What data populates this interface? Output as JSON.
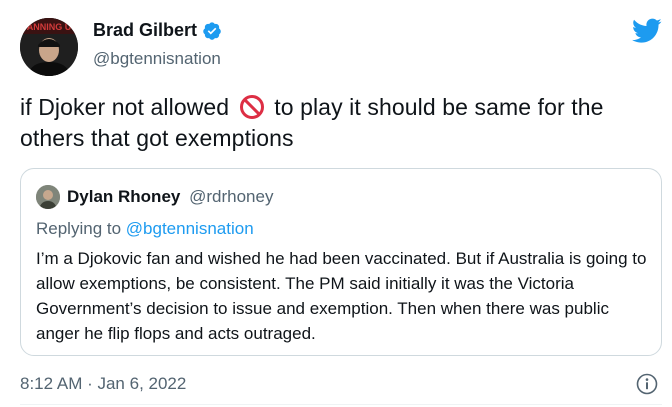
{
  "author": {
    "name": "Brad Gilbert",
    "handle": "@bgtennisnation",
    "verified": true,
    "avatar_text": "ANNING U"
  },
  "tweet": {
    "text_before": "if Djoker not allowed",
    "emoji": "no-entry-sign",
    "text_after": "to play it should be same for the others that got exemptions",
    "timestamp": "8:12 AM · Jan 6, 2022"
  },
  "quoted": {
    "name": "Dylan Rhoney",
    "handle": "@rdrhoney",
    "replying_prefix": "Replying to",
    "replying_to": "@bgtennisnation",
    "text": "I’m a Djokovic fan and wished he had been vaccinated. But if Australia is going to allow exemptions, be consistent. The PM said initially it was the Victoria Government’s decision to issue and exemption. Then when there was public anger he flip flops and acts outraged."
  },
  "icons": {
    "brand": "twitter-bird-icon",
    "verified": "verified-badge-icon",
    "info": "info-icon"
  },
  "colors": {
    "twitter_blue": "#1d9bf0",
    "text": "#0f1419",
    "secondary": "#536471",
    "border": "#cfd9de"
  }
}
